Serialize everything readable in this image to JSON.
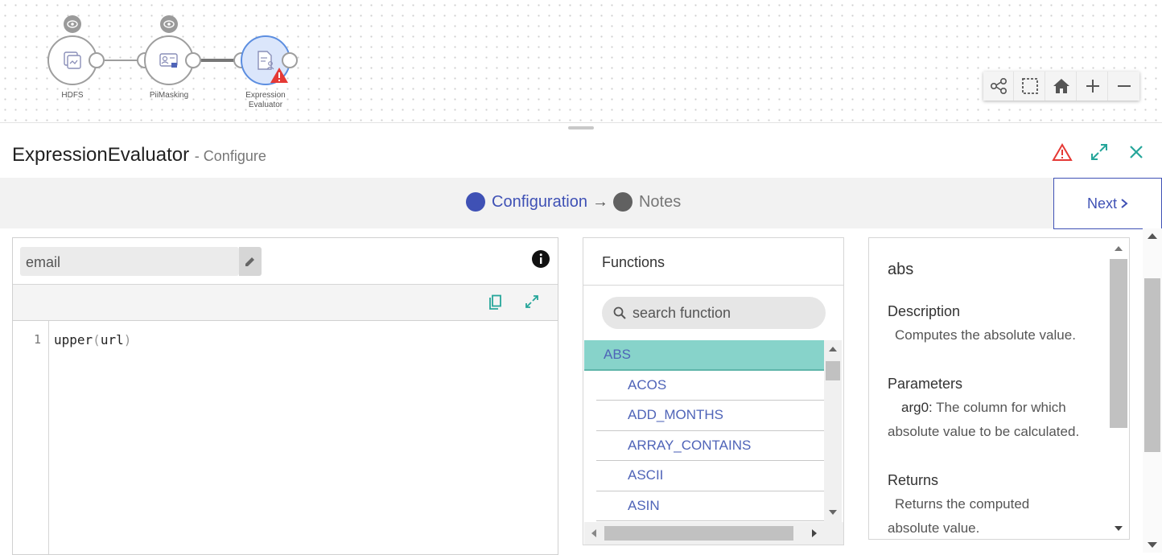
{
  "pipeline": {
    "nodes": [
      {
        "label": "HDFS"
      },
      {
        "label": "PiiMasking"
      },
      {
        "label_line1": "Expression",
        "label_line2": "Evaluator"
      }
    ]
  },
  "header": {
    "title": "ExpressionEvaluator",
    "subtitle": "- Configure"
  },
  "stepper": {
    "step1": "Configuration",
    "arrow": "→",
    "step2": "Notes",
    "next_label": "Next"
  },
  "editor": {
    "field_name": "email",
    "line_number": "1",
    "code_fn": "upper",
    "code_open": "(",
    "code_arg": "url",
    "code_close": ")"
  },
  "functions": {
    "title": "Functions",
    "search_placeholder": "search function",
    "items": [
      "ABS",
      "ACOS",
      "ADD_MONTHS",
      "ARRAY_CONTAINS",
      "ASCII",
      "ASIN"
    ]
  },
  "doc": {
    "name": "abs",
    "description_heading": "Description",
    "description_text": "Computes the absolute value.",
    "parameters_heading": "Parameters",
    "param_name": "arg0:",
    "param_text": " The column for which absolute value to be calculated.",
    "returns_heading": "Returns",
    "returns_text": "Returns the computed absolute value."
  },
  "colors": {
    "accent": "#3f51b5",
    "selected_row": "#87d3ca",
    "warning": "#e53935",
    "teal_icon": "#26a69a"
  }
}
